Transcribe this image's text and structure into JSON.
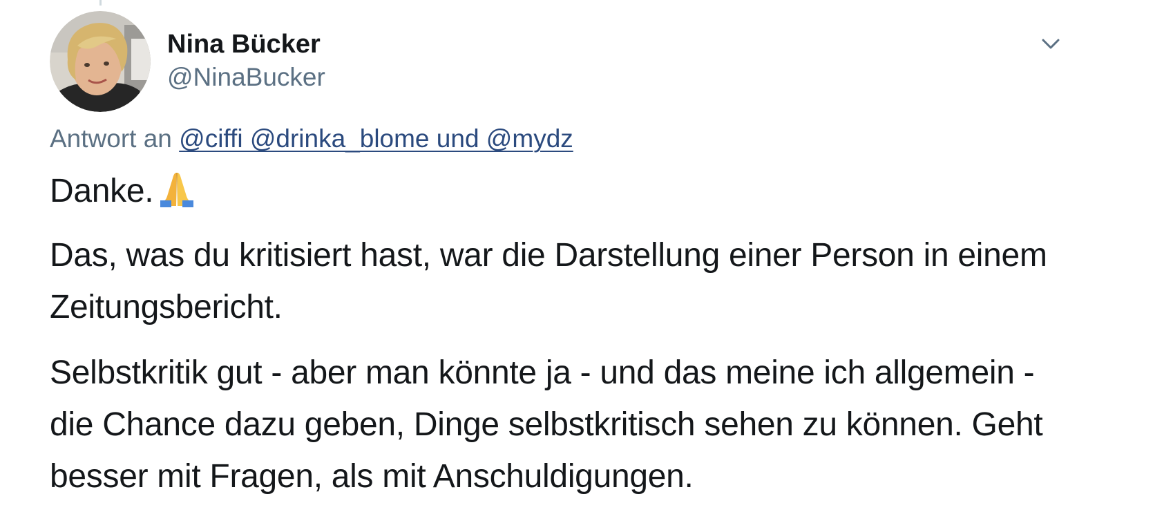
{
  "tweet": {
    "author": {
      "display_name": "Nina Bücker",
      "handle": "@NinaBucker"
    },
    "menu_icon": "chevron-down-icon",
    "reply_to": {
      "prefix": "Antwort an",
      "mentions": "@ciffi @drinka_blome und @mydz"
    },
    "paragraphs": [
      "Danke.",
      "Das, was du kritisiert hast, war die Darstellung einer Person in einem Zeitungsbericht.",
      "Selbstkritik gut - aber man könnte ja - und das meine ich allgemein - die Chance dazu geben, Dinge selbstkritisch sehen zu können. Geht besser mit Fragen, als mit Anschuldigungen."
    ],
    "emoji": "folded-hands-emoji"
  },
  "colors": {
    "text": "#14171a",
    "secondary": "#5b7083",
    "link": "#2b4a7e"
  }
}
